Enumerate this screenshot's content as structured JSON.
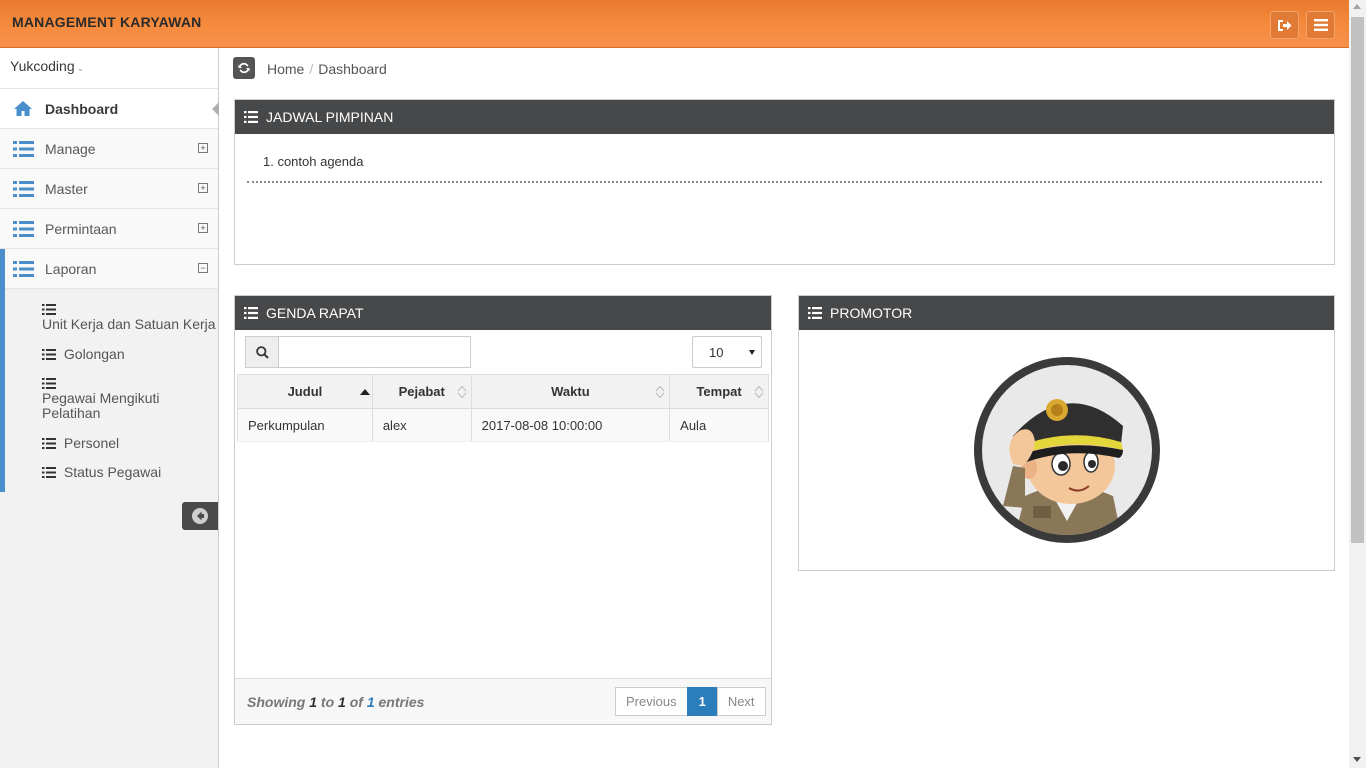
{
  "header": {
    "brand": "MANAGEMENT KARYAWAN"
  },
  "sidebar": {
    "user": "Yukcoding",
    "items": [
      {
        "label": "Dashboard",
        "icon": "home-icon"
      },
      {
        "label": "Manage",
        "toggle": "⊞"
      },
      {
        "label": "Master",
        "toggle": "⊞"
      },
      {
        "label": "Permintaan",
        "toggle": "⊞"
      },
      {
        "label": "Laporan",
        "toggle": "⊟"
      }
    ],
    "laporan_sub": [
      "Unit Kerja dan Satuan Kerja",
      "Golongan",
      "Pegawai Mengikuti Pelatihan",
      "Personel",
      "Status Pegawai"
    ]
  },
  "breadcrumb": {
    "home": "Home",
    "current": "Dashboard"
  },
  "jadwal": {
    "title": "JADWAL PIMPINAN",
    "items": [
      "1. contoh agenda"
    ]
  },
  "genda": {
    "title": "GENDA RAPAT",
    "search_value": "",
    "page_length": "10",
    "columns": [
      "Judul",
      "Pejabat",
      "Waktu",
      "Tempat"
    ],
    "rows": [
      [
        "Perkumpulan",
        "alex",
        "2017-08-08 10:00:00",
        "Aula"
      ]
    ],
    "info": {
      "prefix": "Showing",
      "from": "1",
      "to_word": "to",
      "to": "1",
      "of_word": "of",
      "total": "1",
      "suffix": "entries"
    },
    "pager": {
      "prev": "Previous",
      "current": "1",
      "next": "Next"
    }
  },
  "promotor": {
    "title": "PROMOTOR"
  },
  "colors": {
    "header": "#f58a3c",
    "panel_head": "#47484a",
    "accent": "#2b7dbc"
  }
}
